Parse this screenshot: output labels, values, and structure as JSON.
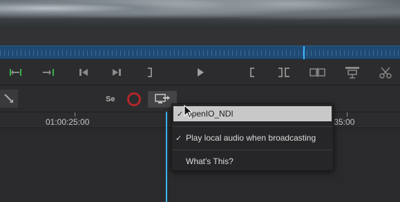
{
  "transport": {
    "icons": [
      "set-in-icon",
      "set-out-icon",
      "step-back-icon",
      "step-forward-icon",
      "bracket-close-icon",
      "play-icon",
      "bracket-open-icon",
      "split-icon",
      "compare-icon",
      "lift-icon",
      "scissors-icon"
    ]
  },
  "toolbar": {
    "se_label": "Se"
  },
  "ruler": {
    "label_1": "01:00:25:00",
    "label_2": ":35:00"
  },
  "context_menu": {
    "items": [
      {
        "label": "openIO_NDI",
        "checked": true
      },
      {
        "label": "Play local audio when broadcasting",
        "checked": true
      },
      {
        "label": "What's This?",
        "checked": false
      }
    ],
    "check_glyph": "✓"
  },
  "colors": {
    "accent_blue": "#39b6ff",
    "record_red": "#b3262a",
    "green": "#38b24a"
  }
}
